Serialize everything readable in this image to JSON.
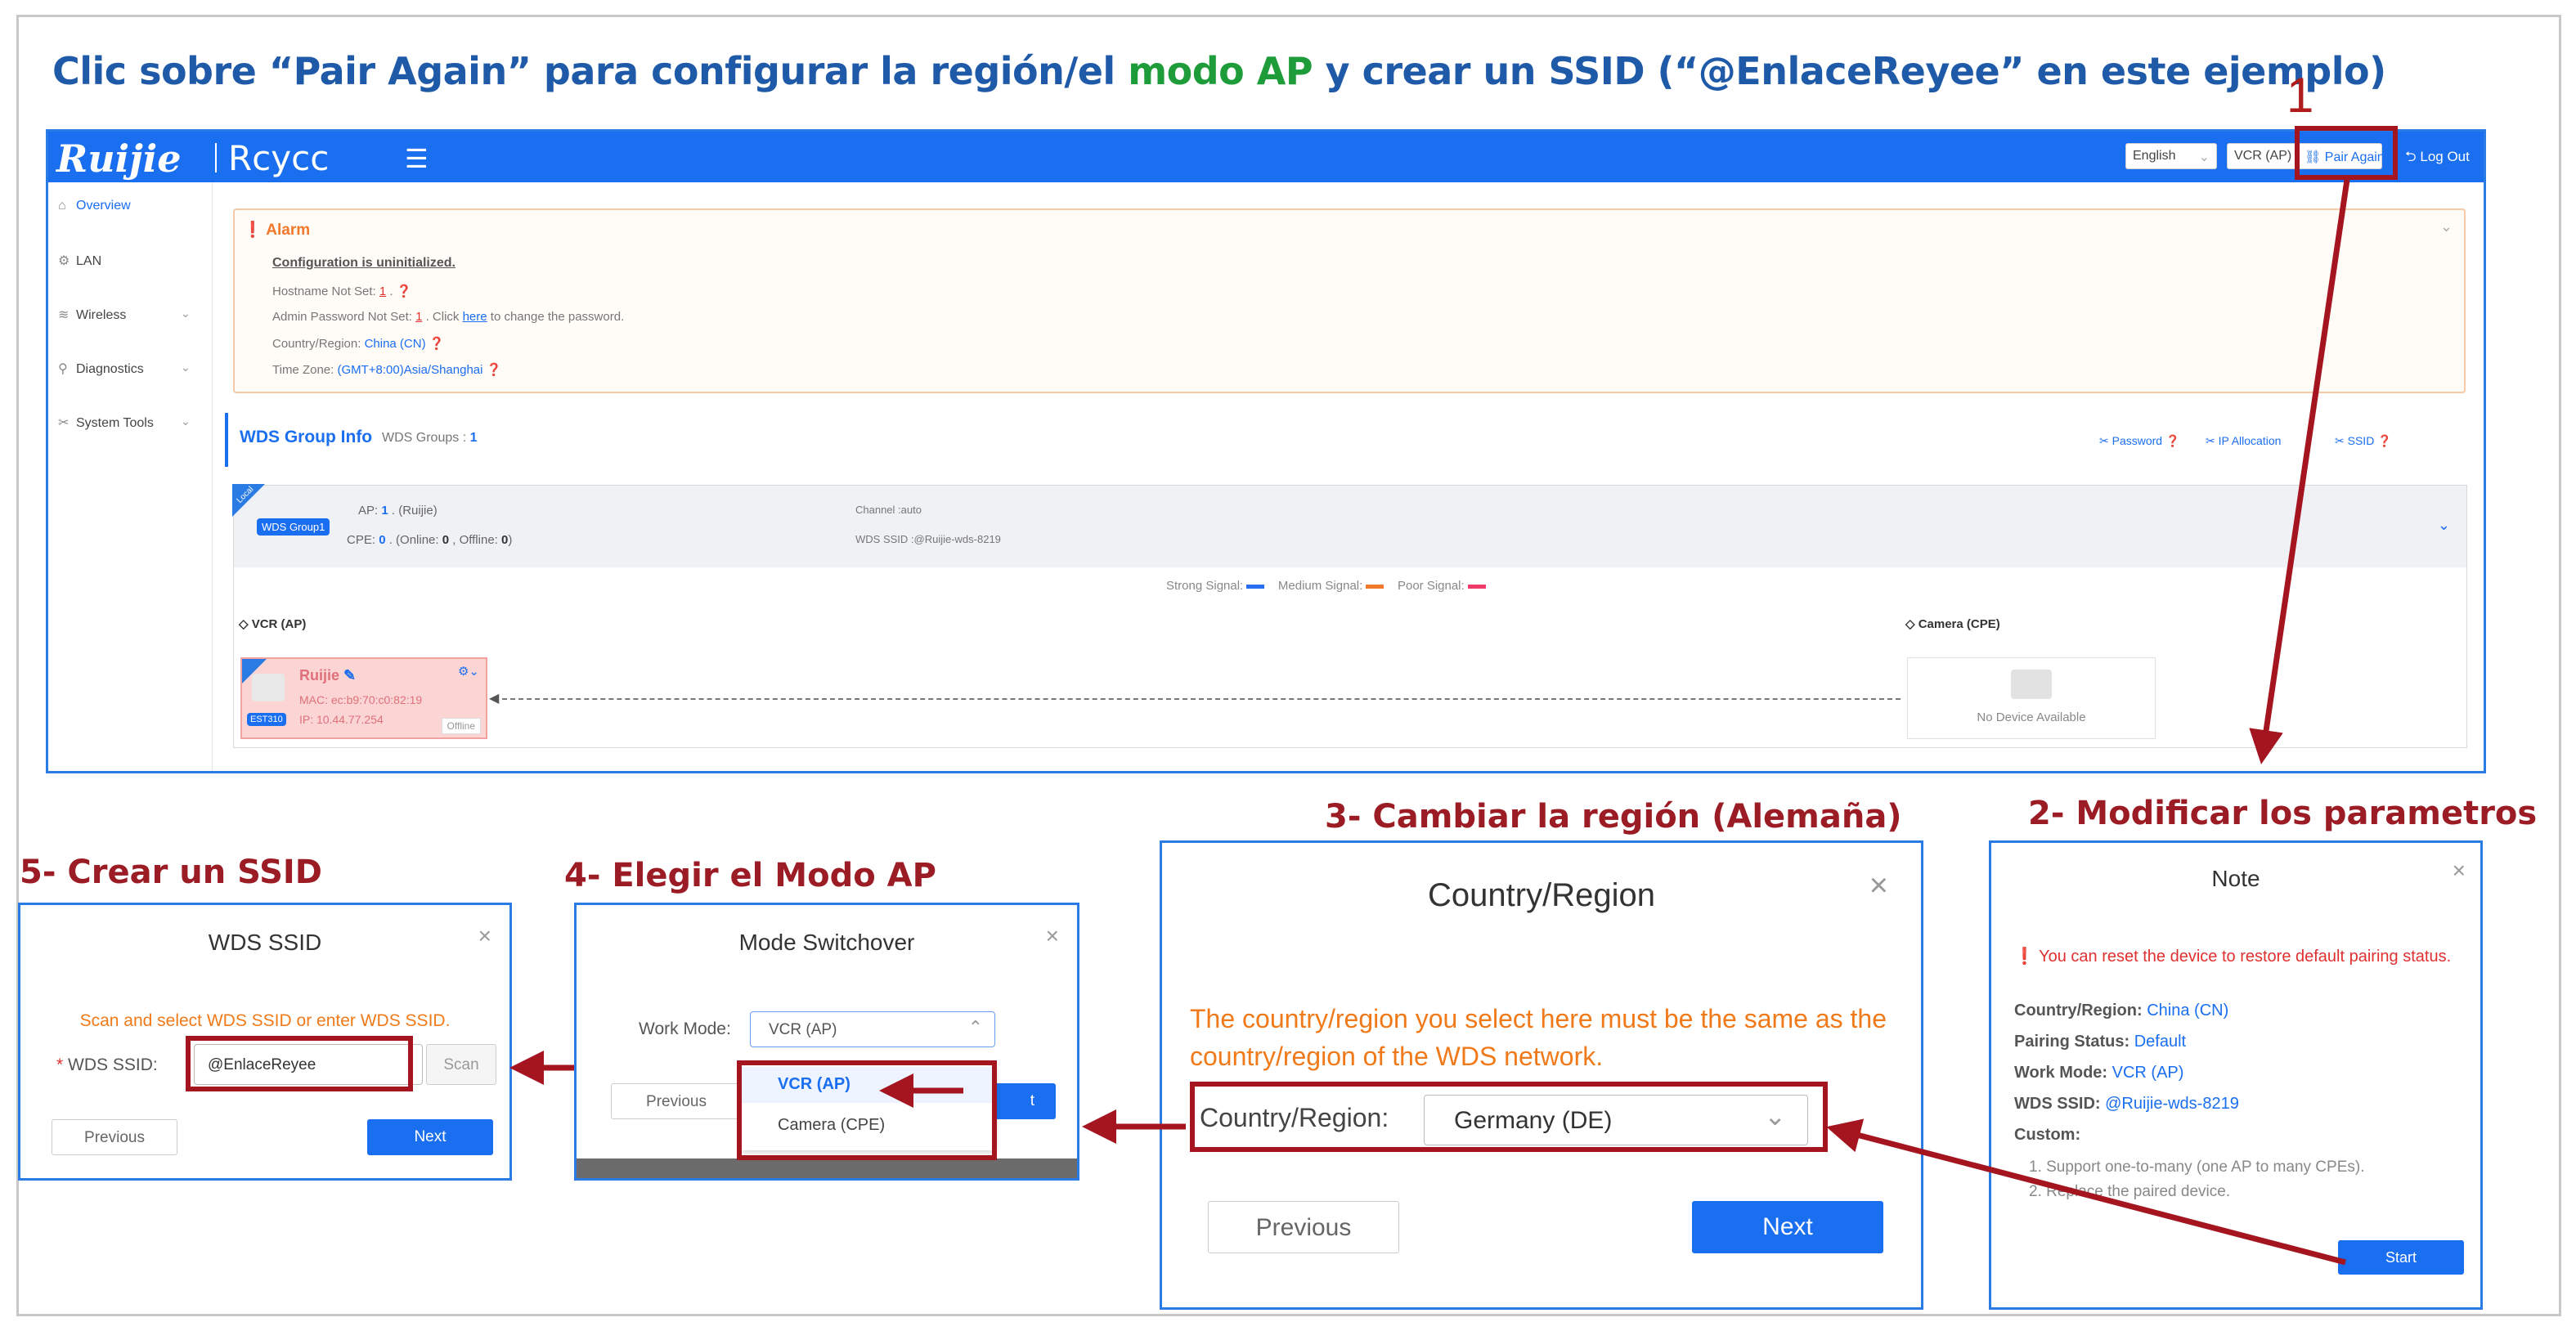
{
  "headline": {
    "part1": "Clic sobre “Pair Again” para configurar la región/el ",
    "part2": "modo AP",
    "part3": " y crear un SSID (“@EnlaceReyee”  en este ejemplo)"
  },
  "steps": {
    "s1": "1",
    "s2": "2- Modificar los parametros",
    "s3": "3- Cambiar la región (Alemaña)",
    "s4": "4- Elegir el Modo AP",
    "s5": "5- Crear un SSID"
  },
  "app": {
    "logo_brand": "Ruijie",
    "logo_product": "Rcycc",
    "menu_icon": "menu-fold-icon",
    "language": "English",
    "work_mode": "VCR (AP)",
    "pair_again": "Pair Again",
    "log_out": "Log Out",
    "sidebar": [
      {
        "label": "Overview",
        "icon": "home-icon"
      },
      {
        "label": "LAN",
        "icon": "gear-icon"
      },
      {
        "label": "Wireless",
        "icon": "wifi-icon"
      },
      {
        "label": "Diagnostics",
        "icon": "diagnostics-icon"
      },
      {
        "label": "System Tools",
        "icon": "tools-icon"
      }
    ],
    "alarm": {
      "title": "Alarm",
      "heading": "Configuration is uninitialized.",
      "hostname_prefix": "Hostname Not Set: ",
      "hostname_count": "1",
      "hostname_suffix": " .",
      "admin_prefix": "Admin Password Not Set: ",
      "admin_count": "1",
      "admin_mid": " . Click ",
      "admin_link": "here",
      "admin_suffix": " to change the password.",
      "country_prefix": "Country/Region: ",
      "country_value": "China (CN)",
      "tz_prefix": "Time Zone: ",
      "tz_value": "(GMT+8:00)Asia/Shanghai"
    },
    "wds": {
      "title": "WDS Group Info",
      "groups_label": "WDS Groups : ",
      "groups_count": "1",
      "action_password": "Password",
      "action_ip": "IP Allocation",
      "action_ssid": "SSID",
      "local_tag": "Local",
      "group_badge": "WDS Group1",
      "ap_label": "AP: ",
      "ap_count": "1",
      "ap_suffix": " . (Ruijie)",
      "cpe_label": "CPE: ",
      "cpe_count": "0",
      "cpe_online_label": " . (Online: ",
      "cpe_online": "0",
      "cpe_offline_label": " , Offline: ",
      "cpe_offline": "0",
      "cpe_close": ")",
      "channel": "Channel :auto",
      "wds_ssid": "WDS SSID :@Ruijie-wds-8219",
      "strong": "Strong Signal:",
      "medium": "Medium Signal:",
      "poor": "Poor Signal:",
      "ap_section": "VCR (AP)",
      "cpe_section": "Camera (CPE)",
      "device_name": "Ruijie",
      "device_mac": "MAC:  ec:b9:70:c0:82:19",
      "device_model": "EST310",
      "device_ip": "IP:  10.44.77.254",
      "device_status": "Offline",
      "no_device": "No Device Available"
    },
    "colors": {
      "strong": "#2a6ef0",
      "medium": "#f07a2a",
      "poor": "#f03a6a"
    }
  },
  "note_dialog": {
    "title": "Note",
    "warning": "You can reset the device to restore default pairing status.",
    "country_label": "Country/Region: ",
    "country_value": "China (CN)",
    "pairing_label": "Pairing Status: ",
    "pairing_value": "Default",
    "mode_label": "Work Mode: ",
    "mode_value": "VCR (AP)",
    "ssid_label": "WDS SSID: ",
    "ssid_value": "@Ruijie-wds-8219",
    "custom_label": "Custom:",
    "custom_1": "1. Support one-to-many (one AP to many CPEs).",
    "custom_2": "2. Replace the paired device.",
    "start": "Start"
  },
  "country_dialog": {
    "title": "Country/Region",
    "message": "The country/region you select here must be the same as the country/region of the WDS network.",
    "field_label": "Country/Region:",
    "field_value": "Germany (DE)",
    "previous": "Previous",
    "next": "Next"
  },
  "mode_dialog": {
    "title": "Mode Switchover",
    "field_label": "Work Mode:",
    "field_value": "VCR (AP)",
    "options": [
      "VCR (AP)",
      "Camera (CPE)"
    ],
    "previous": "Previous",
    "next_partial": "t"
  },
  "ssid_dialog": {
    "title": "WDS SSID",
    "message": "Scan and select WDS SSID or enter WDS SSID.",
    "field_label": "WDS SSID:",
    "required_mark": "*",
    "field_value": "@EnlaceReyee",
    "scan": "Scan",
    "previous": "Previous",
    "next": "Next"
  }
}
